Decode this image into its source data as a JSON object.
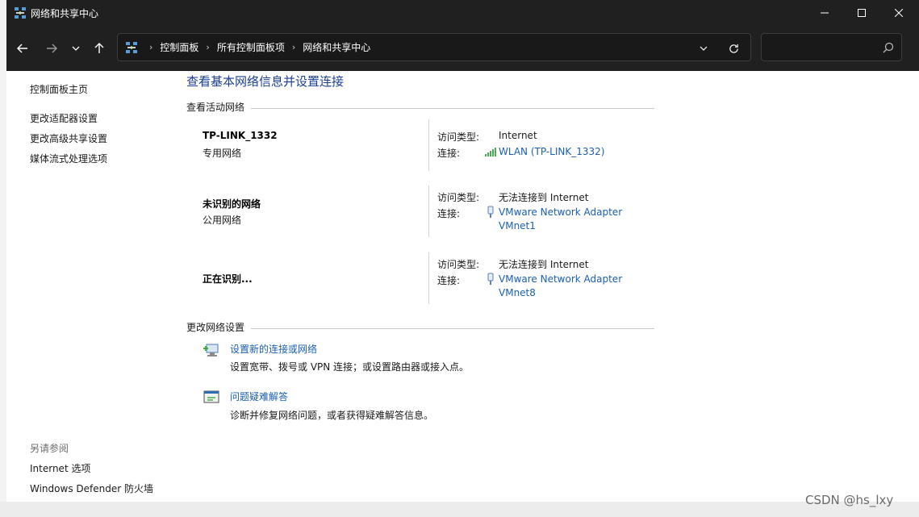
{
  "window": {
    "title": "网络和共享中心",
    "icon": "network-sharing-icon",
    "controls": {
      "minimize": "minimize-icon",
      "maximize": "maximize-icon",
      "close": "close-icon"
    }
  },
  "nav": {
    "back": "back-arrow-icon",
    "forward": "forward-arrow-icon",
    "recent": "chevron-down-icon",
    "up": "up-arrow-icon"
  },
  "address": {
    "crumbs": [
      "控制面板",
      "所有控制面板项",
      "网络和共享中心"
    ],
    "search_placeholder": ""
  },
  "sidebar": {
    "links": [
      "控制面板主页",
      "更改适配器设置",
      "更改高级共享设置",
      "媒体流式处理选项"
    ],
    "see_also_heading": "另请参阅",
    "see_also": [
      "Internet 选项",
      "Windows Defender 防火墙"
    ]
  },
  "main": {
    "title": "查看基本网络信息并设置连接",
    "active_heading": "查看活动网络",
    "access_label": "访问类型:",
    "connection_label": "连接:",
    "networks": [
      {
        "name": "TP-LINK_1332",
        "type": "专用网络",
        "access": "Internet",
        "connection": [
          "WLAN (TP-LINK_1332)"
        ],
        "connection_icon": "wifi-signal-icon"
      },
      {
        "name": "未识别的网络",
        "type": "公用网络",
        "access": "无法连接到 Internet",
        "connection": [
          "VMware Network Adapter",
          "VMnet1"
        ],
        "connection_icon": "ethernet-adapter-icon"
      },
      {
        "name": "正在识别...",
        "type": "",
        "access": "无法连接到 Internet",
        "connection": [
          "VMware Network Adapter",
          "VMnet8"
        ],
        "connection_icon": "ethernet-adapter-icon"
      }
    ],
    "change_heading": "更改网络设置",
    "tasks": [
      {
        "link": "设置新的连接或网络",
        "desc": "设置宽带、拨号或 VPN 连接；或设置路由器或接入点。",
        "icon": "new-connection-icon"
      },
      {
        "link": "问题疑难解答",
        "desc": "诊断并修复网络问题，或者获得疑难解答信息。",
        "icon": "troubleshoot-icon"
      }
    ]
  },
  "watermark": "CSDN @hs_lxy",
  "colors": {
    "titlebar": "#202020",
    "link": "#1a5fb4",
    "title": "#1c3f94"
  }
}
